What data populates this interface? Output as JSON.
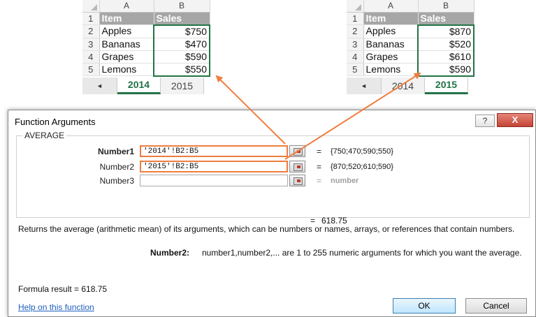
{
  "sheet_2014": {
    "columns": [
      "A",
      "B"
    ],
    "header": {
      "row": "1",
      "item": "Item",
      "sales": "Sales"
    },
    "rows": [
      {
        "n": "2",
        "item": "Apples",
        "sales": "$750"
      },
      {
        "n": "3",
        "item": "Bananas",
        "sales": "$470"
      },
      {
        "n": "4",
        "item": "Grapes",
        "sales": "$590"
      },
      {
        "n": "5",
        "item": "Lemons",
        "sales": "$550"
      }
    ],
    "tabs": [
      "2014",
      "2015"
    ],
    "active_tab": "2014",
    "nav_arrow": "◄"
  },
  "sheet_2015": {
    "columns": [
      "A",
      "B"
    ],
    "header": {
      "row": "1",
      "item": "Item",
      "sales": "Sales"
    },
    "rows": [
      {
        "n": "2",
        "item": "Apples",
        "sales": "$870"
      },
      {
        "n": "3",
        "item": "Bananas",
        "sales": "$520"
      },
      {
        "n": "4",
        "item": "Grapes",
        "sales": "$610"
      },
      {
        "n": "5",
        "item": "Lemons",
        "sales": "$590"
      }
    ],
    "tabs": [
      "2014",
      "2015"
    ],
    "active_tab": "2015",
    "nav_arrow": "◄"
  },
  "dialog": {
    "title": "Function Arguments",
    "help_glyph": "?",
    "close_glyph": "X",
    "function_name": "AVERAGE",
    "args": [
      {
        "label": "Number1",
        "value": "'2014'!B2:B5",
        "result": "{750;470;590;550}"
      },
      {
        "label": "Number2",
        "value": "'2015'!B2:B5",
        "result": "{870;520;610;590}"
      },
      {
        "label": "Number3",
        "value": "",
        "result": "number"
      }
    ],
    "equals": "=",
    "result": "618.75",
    "description": "Returns the average (arithmetic mean) of its arguments, which can be numbers or names, arrays, or references that contain numbers.",
    "arg_help_name": "Number2:",
    "arg_help_text": "number1,number2,... are 1 to 255 numeric arguments for which you want the average.",
    "formula_result_label": "Formula result =",
    "formula_result_value": "618.75",
    "help_link": "Help on this function",
    "ok_label": "OK",
    "cancel_label": "Cancel"
  },
  "colors": {
    "accent_green": "#217346",
    "highlight_orange": "#ef7d3f",
    "link_blue": "#1f5fbf"
  },
  "icons": {
    "ref_button": "collapse-dialog-icon"
  }
}
